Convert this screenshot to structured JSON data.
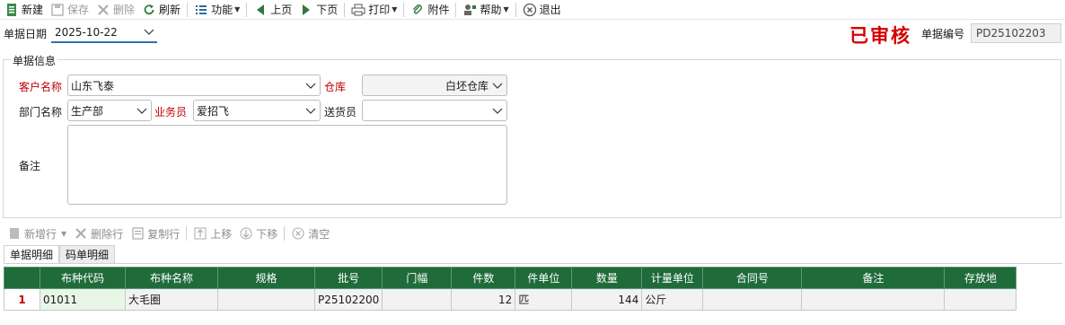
{
  "toolbar": {
    "new": "新建",
    "save": "保存",
    "delete": "删除",
    "refresh": "刷新",
    "function": "功能",
    "prev": "上页",
    "next": "下页",
    "print": "打印",
    "attach": "附件",
    "help": "帮助",
    "exit": "退出"
  },
  "header": {
    "date_label": "单据日期",
    "date_value": "2025-10-22",
    "status_stamp": "已审核",
    "docno_label": "单据编号",
    "docno_value": "PD25102203"
  },
  "form": {
    "group_title": "单据信息",
    "customer_label": "客户名称",
    "customer_value": "山东飞泰",
    "warehouse_label": "仓库",
    "warehouse_value": "白坯仓库",
    "dept_label": "部门名称",
    "dept_value": "生产部",
    "salesman_label": "业务员",
    "salesman_value": "爱招飞",
    "deliverer_label": "送货员",
    "deliverer_value": "",
    "remark_label": "备注",
    "remark_value": ""
  },
  "grid_toolbar": {
    "add_row": "新增行",
    "del_row": "删除行",
    "copy_row": "复制行",
    "move_up": "上移",
    "move_down": "下移",
    "clear": "清空"
  },
  "tabs": [
    "单据明细",
    "码单明细"
  ],
  "grid": {
    "columns": [
      "",
      "布种代码",
      "布种名称",
      "规格",
      "批号",
      "门幅",
      "件数",
      "件单位",
      "数量",
      "计量单位",
      "合同号",
      "备注",
      "存放地"
    ],
    "rows": [
      [
        "1",
        "01011",
        "大毛圈",
        "",
        "P25102200",
        "",
        "12",
        "匹",
        "144",
        "公斤",
        "",
        "",
        ""
      ]
    ]
  },
  "colors": {
    "grid_header": "#1f6b3a",
    "required_label": "#c00000",
    "stamp": "#d40000"
  }
}
